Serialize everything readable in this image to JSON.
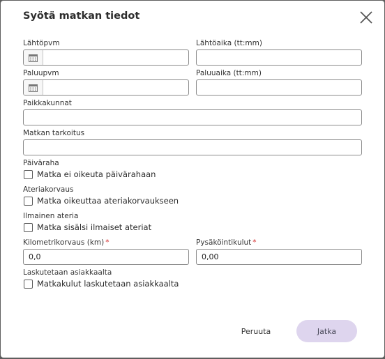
{
  "dialog": {
    "title": "Syötä matkan tiedot",
    "close_icon": "close-icon"
  },
  "fields": {
    "departure_date": {
      "label": "Lähtöpvm",
      "value": "",
      "icon": "calendar-icon"
    },
    "departure_time": {
      "label": "Lähtöaika (tt:mm)",
      "value": ""
    },
    "return_date": {
      "label": "Paluupvm",
      "value": "",
      "icon": "calendar-icon"
    },
    "return_time": {
      "label": "Paluuaika (tt:mm)",
      "value": ""
    },
    "locations": {
      "label": "Paikkakunnat",
      "value": ""
    },
    "purpose": {
      "label": "Matkan tarkoitus",
      "value": ""
    },
    "mileage": {
      "label": "Kilometrikorvaus (km)",
      "required_mark": "*",
      "value": "0,0"
    },
    "parking": {
      "label": "Pysäköintikulut",
      "required_mark": "*",
      "value": "0,00"
    }
  },
  "checkboxes": {
    "per_diem": {
      "section_label": "Päiväraha",
      "label": "Matka ei oikeuta päivärahaan",
      "checked": false
    },
    "meal": {
      "section_label": "Ateriakorvaus",
      "label": "Matka oikeuttaa ateriakorvaukseen",
      "checked": false
    },
    "free_meal": {
      "section_label": "Ilmainen ateria",
      "label": "Matka sisälsi ilmaiset ateriat",
      "checked": false
    },
    "billing": {
      "section_label": "Laskutetaan asiakkaalta",
      "label": "Matkakulut laskutetaan asiakkaalta",
      "checked": false
    }
  },
  "buttons": {
    "cancel": "Peruuta",
    "next": "Jatka"
  },
  "colors": {
    "primary_button_bg": "#ded5ee",
    "required": "#d32f2f",
    "overlay": "#5e5e5e"
  }
}
